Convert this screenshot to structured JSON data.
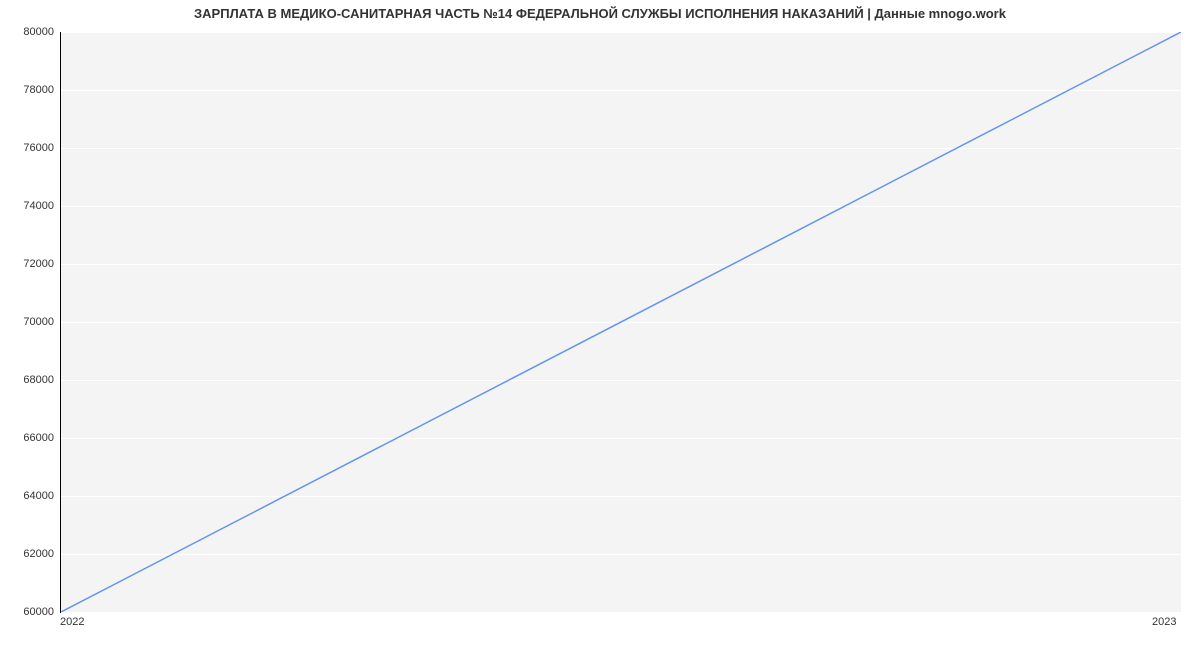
{
  "chart_data": {
    "type": "line",
    "title": "ЗАРПЛАТА В  МЕДИКО-САНИТАРНАЯ ЧАСТЬ №14 ФЕДЕРАЛЬНОЙ СЛУЖБЫ ИСПОЛНЕНИЯ НАКАЗАНИЙ | Данные mnogo.work",
    "x": [
      "2022",
      "2023"
    ],
    "values": [
      60000,
      80000
    ],
    "xlabel": "",
    "ylabel": "",
    "xlim": [
      "2022",
      "2023"
    ],
    "ylim": [
      60000,
      80000
    ],
    "yticks": [
      60000,
      62000,
      64000,
      66000,
      68000,
      70000,
      72000,
      74000,
      76000,
      78000,
      80000
    ],
    "xticks": [
      "2022",
      "2023"
    ],
    "line_color": "#6495ed",
    "grid": true,
    "background": "#f4f4f4"
  }
}
